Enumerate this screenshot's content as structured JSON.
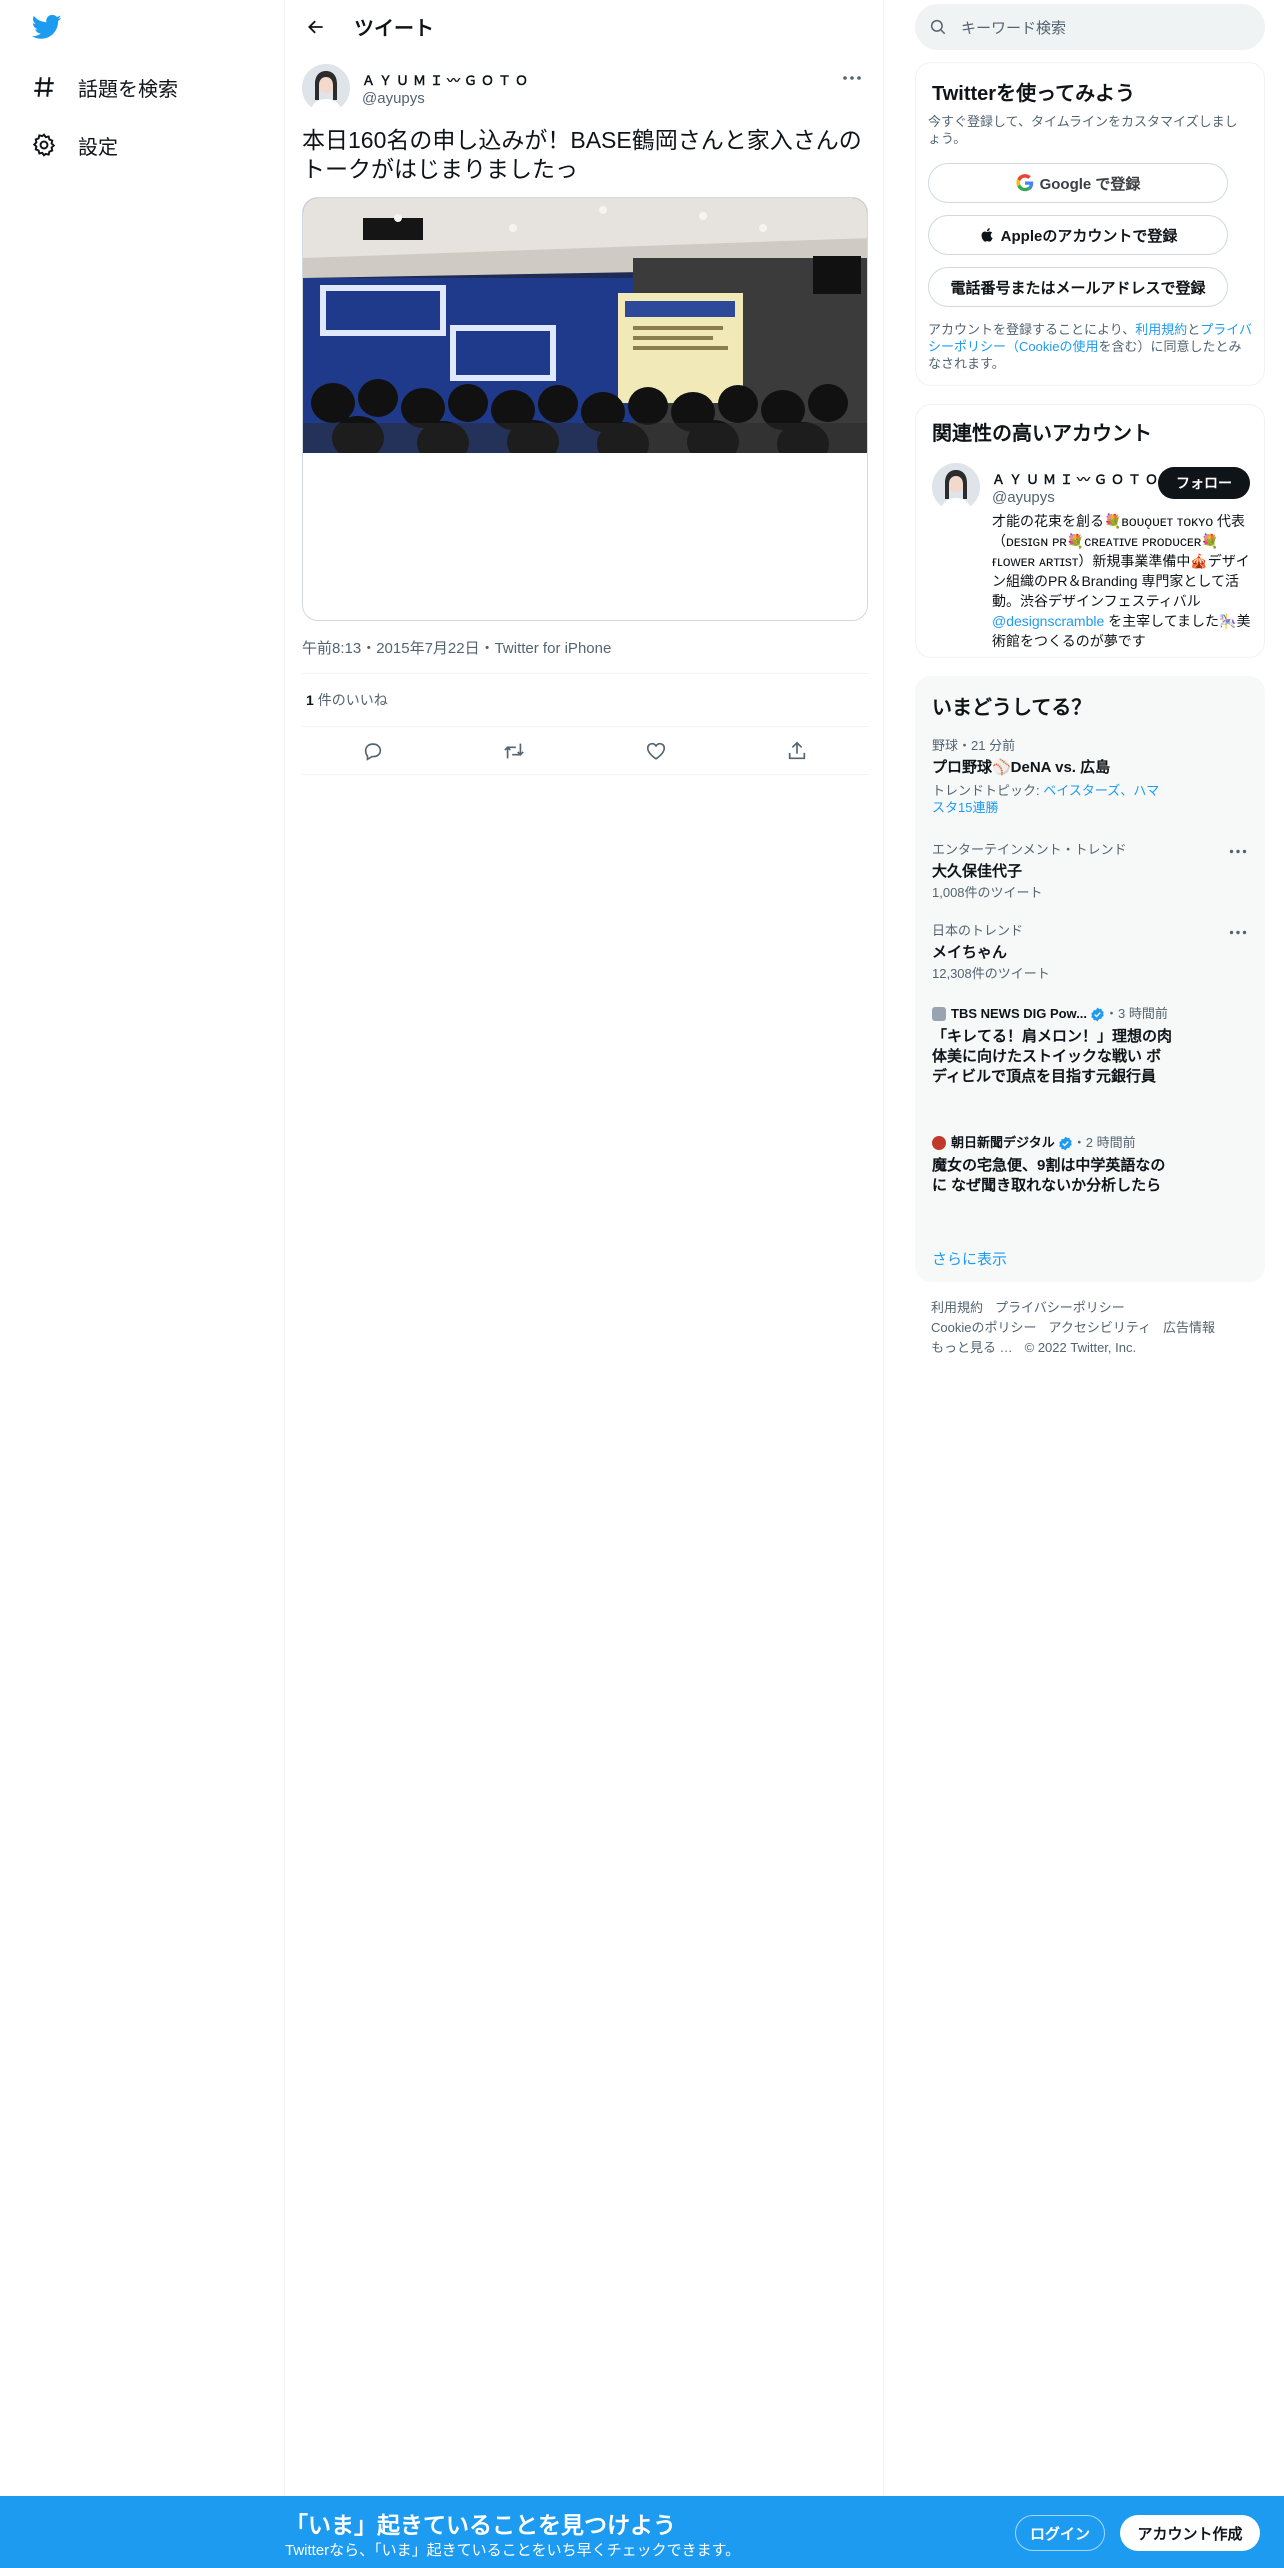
{
  "nav": {
    "logo_icon": "twitter-bird-icon",
    "items": [
      {
        "icon": "hashtag-icon",
        "label": "話題を検索"
      },
      {
        "icon": "gear-icon",
        "label": "設定"
      }
    ]
  },
  "main": {
    "title": "ツイート",
    "tweet": {
      "author_name": "ＡＹＵＭＩ〰ＧＯＴＯ",
      "author_handle": "@ayupys",
      "text": "本日160名の申し込みが！BASE鶴岡さんと家入さんのトークがはじまりましたっ",
      "meta": "午前8:13・2015年7月22日・Twitter for iPhone",
      "like_count": "1",
      "like_label": "件のいいね"
    }
  },
  "search": {
    "placeholder": "キーワード検索"
  },
  "signup_panel": {
    "title": "Twitterを使ってみよう",
    "subtitle": "今すぐ登録して、タイムラインをカスタマイズしましょう。",
    "google_label": "Google で登録",
    "apple_label": "Appleのアカウントで登録",
    "phone_label": "電話番号またはメールアドレスで登録",
    "terms_prefix": "アカウントを登録することにより、",
    "terms_link": "利用規約",
    "terms_and": "と",
    "privacy_link": "プライバシーポリシー（Cookieの使用",
    "terms_suffix": "を含む）に同意したとみなされます。"
  },
  "related_panel": {
    "title": "関連性の高いアカウント",
    "name": "ＡＹＵＭＩ〰ＧＯＴＯ",
    "handle": "@ayupys",
    "follow_label": "フォロー",
    "bio_1": "才能の花束を創る💐ʙᴏᴜǫᴜᴇᴛ ᴛᴏᴋʏᴏ 代表（ᴅᴇsɪɢɴ ᴘʀ💐ᴄʀᴇᴀᴛɪᴠᴇ ᴘʀᴏᴅᴜᴄᴇʀ💐ғʟᴏᴡᴇʀ ᴀʀᴛɪsᴛ）新規事業準備中🎪デザイン組織のPR＆Branding 専門家として活動。渋谷デザインフェスティバル ",
    "bio_link": "@designscramble",
    "bio_2": " を主宰してました🎠美術館をつくるのが夢です"
  },
  "trends_panel": {
    "title": "いまどうしてる？",
    "items": [
      {
        "context": "野球・21 分前",
        "title": "プロ野球⚾DeNA vs. 広島",
        "topics_label": "トレンドトピック: ",
        "topics": "ベイスターズ、ハマスタ15連勝"
      },
      {
        "context": "エンターテインメント・トレンド",
        "title": "大久保佳代子",
        "count": "1,008件のツイート"
      },
      {
        "context": "日本のトレンド",
        "title": "メイちゃん",
        "count": "12,308件のツイート"
      },
      {
        "source": "TBS NEWS DIG Pow...",
        "time": "・3 時間前",
        "title": "「キレてる！肩メロン！」理想の肉体美に向けたストイックな戦い ボディビルで頂点を目指す元銀行員"
      },
      {
        "source": "朝日新聞デジタル",
        "time": "・2 時間前",
        "title": "魔女の宅急便、9割は中学英語なのに なぜ聞き取れないか分析したら"
      }
    ],
    "show_more": "さらに表示"
  },
  "footer": {
    "links": [
      "利用規約",
      "プライバシーポリシー",
      "Cookieのポリシー",
      "アクセシビリティ",
      "広告情報",
      "もっと見る …"
    ],
    "copyright": "© 2022 Twitter, Inc."
  },
  "banner": {
    "title": "「いま」起きていることを見つけよう",
    "subtitle": "Twitterなら、「いま」起きていることをいち早くチェックできます。",
    "login_label": "ログイン",
    "signup_label": "アカウント作成"
  },
  "colors": {
    "accent": "#1d9bf0",
    "text": "#0f1419",
    "muted": "#536471",
    "border": "#eff3f4",
    "panel_bg": "#f7f9f9"
  }
}
